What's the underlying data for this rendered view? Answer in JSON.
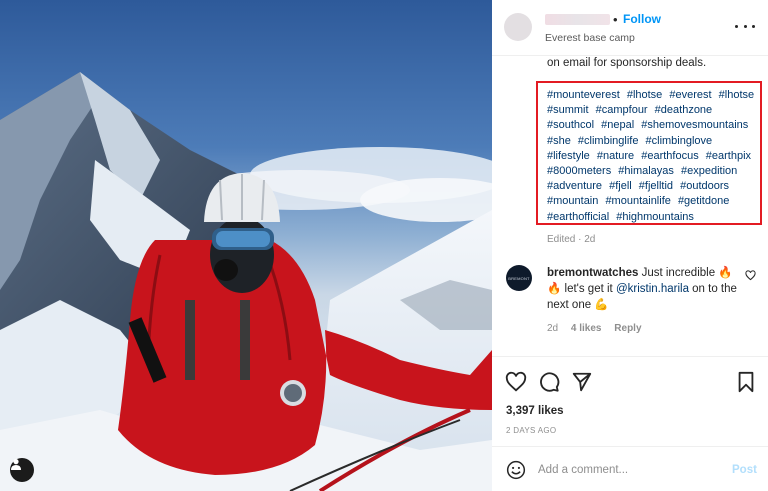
{
  "post": {
    "location": "Everest base camp",
    "follow_label": "Follow",
    "dot": "•",
    "caption_top": "on email for sponsorship deals.",
    "hashtags": [
      "#mounteverest",
      "#lhotse",
      "#everest",
      "#lhotse",
      "#summit",
      "#campfour",
      "#deathzone",
      "#southcol",
      "#nepal",
      "#shemovesmountains",
      "#she",
      "#climbinglife",
      "#climbinglove",
      "#lifestyle",
      "#nature",
      "#earthfocus",
      "#earthpix",
      "#8000meters",
      "#himalayas",
      "#expedition",
      "#adventure",
      "#fjell",
      "#fjelltid",
      "#outdoors",
      "#mountain",
      "#mountainlife",
      "#getitdone",
      "#earthofficial",
      "#highmountains"
    ],
    "edited": "Edited · 2d"
  },
  "comment": {
    "avatar_text": "BREMONT",
    "username": "bremontwatches",
    "text_1": " Just incredible 🔥🔥 let's get it ",
    "mention": "@kristin.harila",
    "text_2": " on to the next one 💪",
    "age": "2d",
    "likes": "4 likes",
    "reply": "Reply"
  },
  "stats": {
    "likes": "3,397 likes",
    "date": "2 DAYS AGO"
  },
  "comment_box": {
    "placeholder": "Add a comment...",
    "post_label": "Post"
  },
  "icons": {
    "like": "heart-icon",
    "comment": "comment-icon",
    "share": "send-icon",
    "save": "bookmark-icon",
    "emoji": "emoji-icon",
    "more": "more-icon",
    "user_tag": "user-icon"
  },
  "colors": {
    "link": "#0095f6",
    "hashtag": "#00376b",
    "highlight_box": "#e31b23",
    "muted": "#8e8e8e"
  }
}
